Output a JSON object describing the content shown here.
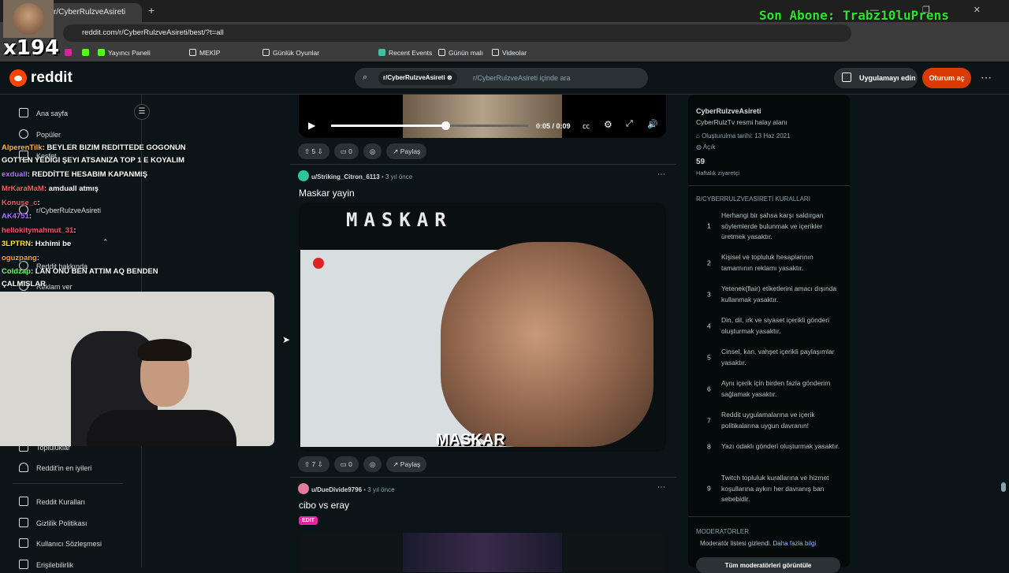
{
  "browser": {
    "tab_title": "r/CyberRulzveAsireti",
    "url": "reddit.com/r/CyberRulzveAsireti/best/?t=all",
    "bookmarks": [
      "Yayıncı Paneli",
      "MEKİP",
      "Günlük Oyunlar",
      "Recent Events",
      "Günün malı",
      "Videolar"
    ]
  },
  "stream": {
    "counter": "x194",
    "last_sub": "Son Abone: Trabz10luPrens"
  },
  "header": {
    "logo_text": "reddit",
    "search_chip": "r/CyberRulzveAsireti",
    "search_placeholder": "r/CyberRulzveAsireti içinde ara",
    "get_app": "Uygulamayı edin",
    "login": "Oturum aç"
  },
  "leftnav": {
    "home": "Ana sayfa",
    "popular": "Popüler",
    "explore": "Keşfet",
    "community": "r/CyberRulzveAsireti",
    "about": "Reddit hakkında",
    "ads": "Reklam ver",
    "topics": "Topluluklar",
    "best": "Reddit'in en iyileri",
    "rules": "Reddit Kuralları",
    "privacy": "Gizlilik Politikası",
    "agreement": "Kullanıcı Sözleşmesi",
    "access": "Erişilebilirlik"
  },
  "chat": [
    {
      "user": "AlperenTilk",
      "color": "#ffb347",
      "msg": ": BEYLER BIZIM REDITTEDE GOGONUN"
    },
    {
      "user": "",
      "color": "#ffffff",
      "msg": "GOTTEN YEDIGI ŞEYI ATSANIZA TOP 1 E KOYALIM"
    },
    {
      "user": "exduall",
      "color": "#b070ff",
      "msg": ": REDDİTTE HESABIM KAPANMIŞ"
    },
    {
      "user": "MrKaraMaM",
      "color": "#ff5c5c",
      "msg": ": amduall atmış"
    },
    {
      "user": "Konuşe_c",
      "color": "#ff4f6d",
      "msg": ":"
    },
    {
      "user": "AK4751",
      "color": "#b070ff",
      "msg": ":"
    },
    {
      "user": "hellokitymahmut_31",
      "color": "#ff4f6d",
      "msg": ":"
    },
    {
      "user": "3LPTRN",
      "color": "#ffe14a",
      "msg": ": Hxhimi be"
    },
    {
      "user": "oguzpang",
      "color": "#ff9f30",
      "msg": ":"
    },
    {
      "user": "Coldzap",
      "color": "#66ff66",
      "msg": ": LAN ONU BEN ATTIM AQ BENDEN"
    },
    {
      "user": "",
      "color": "#ffffff",
      "msg": "ÇALMIŞLAR"
    }
  ],
  "video": {
    "time": "0:05 / 0:09",
    "progress": 0.58
  },
  "posts": [
    {
      "upvotes": "5",
      "comments": "0",
      "share": "Paylaş"
    },
    {
      "user": "u/Striking_Citron_6113",
      "age": "3 yıl önce",
      "title": "Maskar yayin",
      "image_text_top": "MASKAR",
      "image_text_bottom": "MASKAR",
      "upvotes": "7",
      "comments": "0",
      "share": "Paylaş"
    },
    {
      "user": "u/DueDivide9796",
      "age": "3 yıl önce",
      "title": "cibo vs eray",
      "flair": "EDIT"
    }
  ],
  "sidebar": {
    "name": "CyberRulzveAsireti",
    "desc": "CyberRulzTv resmi halay alanı",
    "created": "Oluşturulma tarihi: 13 Haz 2021",
    "status": "Açık",
    "visitors": "59",
    "visitors_label": "Haftalık ziyaretçi",
    "rules_title": "R/CYBERRULZVEASİRETİ KURALLARI",
    "rules": [
      "Herhangi bir şahsa karşı saldırgan söylemlerde bulunmak ve içerikler üretmek yasaktır.",
      "Kişisel ve topluluk hesaplarının tamamının reklamı yasaktır.",
      "Yetenek(flair) etiketlerini amacı dışında kullanmak yasaktır.",
      "Din, dil, ırk ve siyaset içerikli gönderi oluşturmak yasaktır.",
      "Cinsel, kan, vahşet içerikli paylaşımlar yasaktır.",
      "Aynı içerik için birden fazla gönderim sağlamak yasaktır.",
      "Reddit uygulamalarına ve içerik politikalarına uygun davranın!",
      "Yazı odaklı gönderi oluşturmak yasaktır.",
      "Twitch topluluk kurallarına ve hizmet koşullarına aykırı her davranış ban sebebidir."
    ],
    "mods_title": "MODERATÖRLER",
    "mods_hidden": "Moderatör listesi gizlendi.",
    "mods_more": "Daha fazla bilgi",
    "mods_button": "Tüm moderatörleri görüntüle"
  }
}
